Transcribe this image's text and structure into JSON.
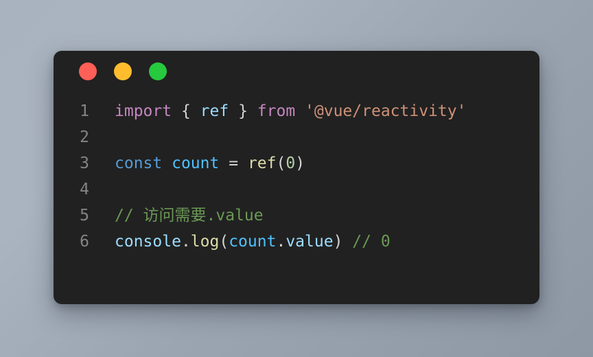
{
  "window": {
    "controls": [
      {
        "name": "close",
        "color": "#ff5f56"
      },
      {
        "name": "minimize",
        "color": "#ffbd2e"
      },
      {
        "name": "maximize",
        "color": "#27c93f"
      }
    ]
  },
  "editor": {
    "background": "#212121",
    "gutter_color": "#858585",
    "lines": [
      {
        "number": "1",
        "tokens": [
          {
            "text": "import",
            "kind": "keyword"
          },
          {
            "text": " ",
            "kind": "punct"
          },
          {
            "text": "{",
            "kind": "punct"
          },
          {
            "text": " ",
            "kind": "punct"
          },
          {
            "text": "ref",
            "kind": "prop"
          },
          {
            "text": " ",
            "kind": "punct"
          },
          {
            "text": "}",
            "kind": "punct"
          },
          {
            "text": " ",
            "kind": "punct"
          },
          {
            "text": "from",
            "kind": "keyword"
          },
          {
            "text": " ",
            "kind": "punct"
          },
          {
            "text": "'@vue/reactivity'",
            "kind": "string"
          }
        ]
      },
      {
        "number": "2",
        "tokens": []
      },
      {
        "number": "3",
        "tokens": [
          {
            "text": "const",
            "kind": "blue"
          },
          {
            "text": " ",
            "kind": "punct"
          },
          {
            "text": "count",
            "kind": "var"
          },
          {
            "text": " ",
            "kind": "punct"
          },
          {
            "text": "=",
            "kind": "punct"
          },
          {
            "text": " ",
            "kind": "punct"
          },
          {
            "text": "ref",
            "kind": "func"
          },
          {
            "text": "(",
            "kind": "punct"
          },
          {
            "text": "0",
            "kind": "num"
          },
          {
            "text": ")",
            "kind": "punct"
          }
        ]
      },
      {
        "number": "4",
        "tokens": []
      },
      {
        "number": "5",
        "tokens": [
          {
            "text": "// 访问需要.value",
            "kind": "comment"
          }
        ]
      },
      {
        "number": "6",
        "tokens": [
          {
            "text": "console",
            "kind": "prop"
          },
          {
            "text": ".",
            "kind": "punct"
          },
          {
            "text": "log",
            "kind": "func"
          },
          {
            "text": "(",
            "kind": "punct"
          },
          {
            "text": "count",
            "kind": "var"
          },
          {
            "text": ".",
            "kind": "punct"
          },
          {
            "text": "value",
            "kind": "prop"
          },
          {
            "text": ")",
            "kind": "punct"
          },
          {
            "text": " ",
            "kind": "punct"
          },
          {
            "text": "// 0",
            "kind": "comment"
          }
        ]
      }
    ]
  }
}
